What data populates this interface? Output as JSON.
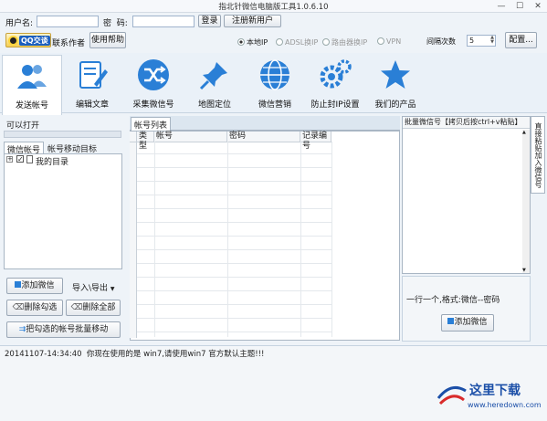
{
  "window": {
    "title": "指北针微信电脑版工具1.0.6.10",
    "min_glyph": "—",
    "max_glyph": "☐",
    "close_glyph": "✕"
  },
  "login": {
    "username_label": "用户名:",
    "password_label": "密  码:",
    "username_value": "",
    "password_value": "",
    "login_button": "登录",
    "register_button": "注册新用户"
  },
  "toolbar": {
    "qq_label": "QQ交谈",
    "contact_author": "联系作者",
    "help_button": "使用帮助",
    "network_options": [
      {
        "label": "本地IP",
        "selected": true
      },
      {
        "label": "ADSL换IP",
        "selected": false
      },
      {
        "label": "路由器换IP",
        "selected": false
      },
      {
        "label": "VPN",
        "selected": false
      }
    ],
    "interval_label": "间隔次数",
    "interval_value": "5",
    "config_button": "配置..."
  },
  "nav": [
    {
      "label": "发送帐号",
      "icon": "users-icon",
      "active": true
    },
    {
      "label": "编辑文章",
      "icon": "edit-doc-icon",
      "active": false
    },
    {
      "label": "采集微信号",
      "icon": "shuffle-icon",
      "active": false
    },
    {
      "label": "地图定位",
      "icon": "pushpin-icon",
      "active": false
    },
    {
      "label": "微信营销",
      "icon": "globe-icon",
      "active": false
    },
    {
      "label": "防止封IP设置",
      "icon": "gears-icon",
      "active": false
    },
    {
      "label": "我们的产品",
      "icon": "star-icon",
      "active": false
    }
  ],
  "left": {
    "open_label": "可以打开",
    "tabs": [
      "微信帐号",
      "帐号移动目标"
    ],
    "tree_root": "我的目录",
    "add_wechat": "添加微信",
    "import_export": "导入\\导出",
    "delete_checked": "删除勾选",
    "delete_all": "删除全部",
    "batch_move": "把勾选的帐号批量移动"
  },
  "grid": {
    "tab": "帐号列表",
    "columns": [
      "类型",
      "帐号",
      "密码",
      "记录编号"
    ]
  },
  "right": {
    "header": "批量微信号【拷贝后按ctrl+v粘贴】",
    "side_tab": "直接粘贴加入微信号",
    "hint": "一行一个,格式:微信--密码",
    "add_button": "添加微信"
  },
  "status": {
    "message": "20141107-14:34:40  你现在使用的是 win7,请使用win7 官方默认主题!!!",
    "watermark_site": "www.heredown.com",
    "watermark_name": "这里下载"
  },
  "colors": {
    "accent_blue": "#2a7fd6",
    "panel_border": "#a9b6c4",
    "selection": "#e2eefa"
  }
}
